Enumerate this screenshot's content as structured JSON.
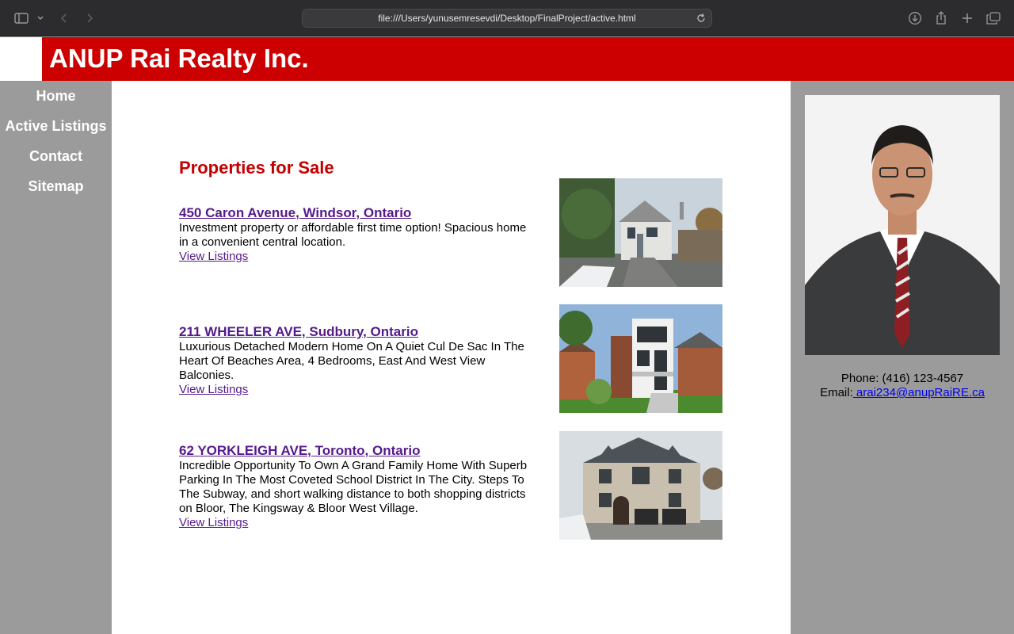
{
  "browser": {
    "url": "file:///Users/yunusemresevdi/Desktop/FinalProject/active.html"
  },
  "header": {
    "brand": "ANUP Rai Realty Inc."
  },
  "nav": {
    "items": [
      {
        "label": "Home"
      },
      {
        "label": "Active Listings"
      },
      {
        "label": "Contact"
      },
      {
        "label": "Sitemap"
      }
    ]
  },
  "main": {
    "heading": "Properties for Sale",
    "listings": [
      {
        "title": "450 Caron Avenue, Windsor, Ontario",
        "description": "Investment property or affordable first time option! Spacious home in a convenient central location.",
        "link": "View Listings"
      },
      {
        "title": "211 WHEELER AVE, Sudbury, Ontario",
        "description": "Luxurious Detached Modern Home On A Quiet Cul De Sac In The Heart Of Beaches Area, 4 Bedrooms, East And West View Balconies.",
        "link": "View Listings"
      },
      {
        "title": "62 YORKLEIGH AVE, Toronto, Ontario",
        "description": "Incredible Opportunity To Own A Grand Family Home With Superb Parking In The Most Coveted School District In The City. Steps To The Subway, and short walking distance to both shopping districts on Bloor, The Kingsway & Bloor West Village.",
        "link": "View Listings"
      }
    ]
  },
  "aside": {
    "phone": "Phone: (416) 123-4567",
    "email_label": "Email:",
    "email": " arai234@anupRaiRE.ca"
  },
  "colors": {
    "brand_red": "#cc0000",
    "heading_red": "#c40000",
    "sidebar_gray": "#9b9b9b",
    "visited_link": "#551a8b",
    "link_blue": "#0000ee"
  }
}
